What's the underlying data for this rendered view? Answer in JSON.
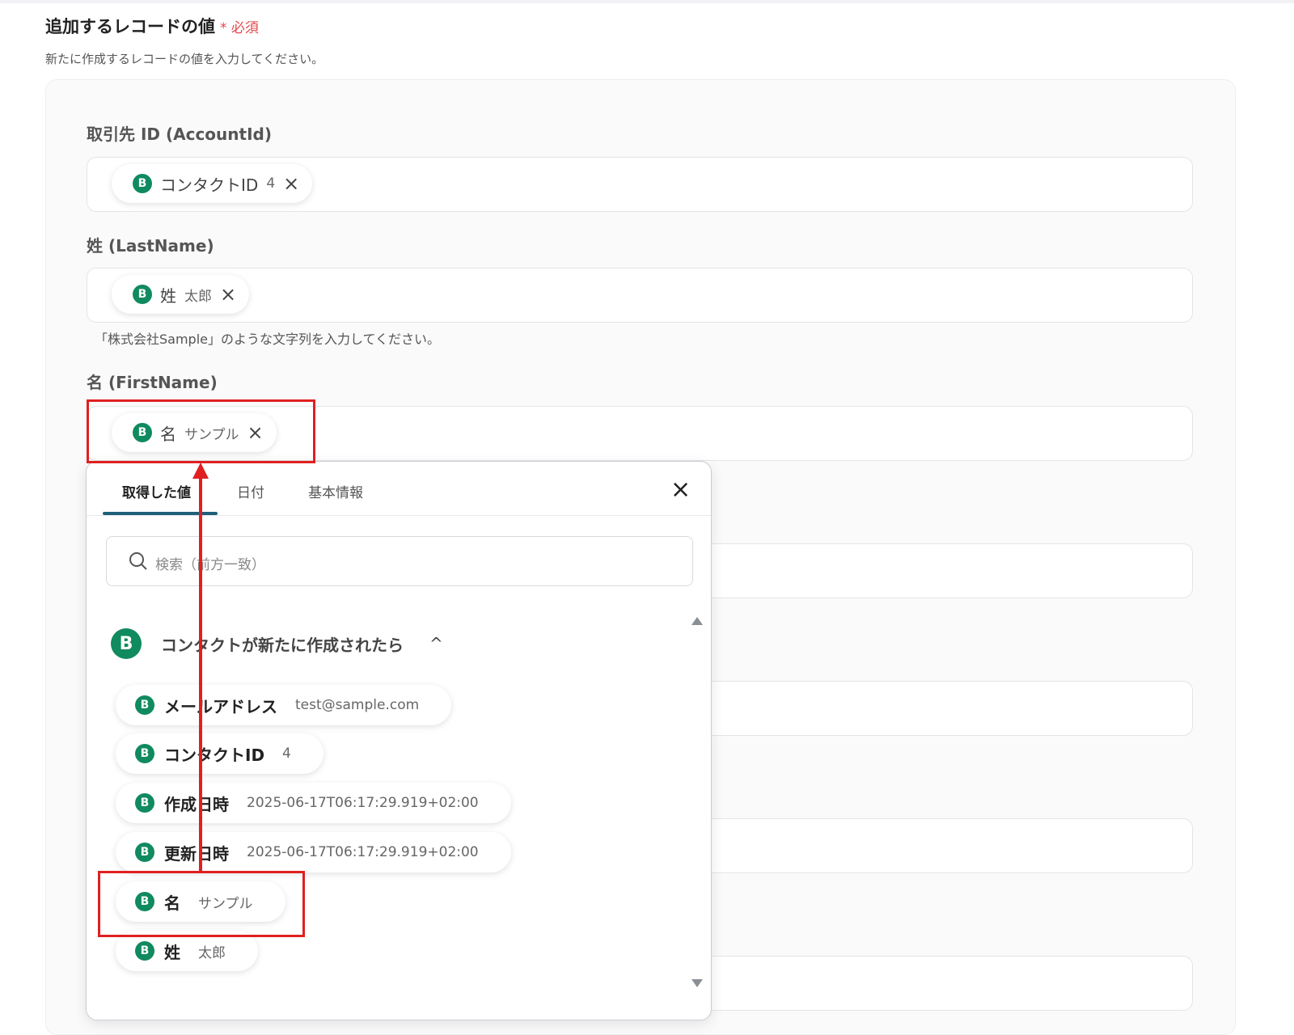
{
  "section": {
    "title": "追加するレコードの値",
    "required": "* 必須",
    "description": "新たに作成するレコードの値を入力してください。"
  },
  "fields": [
    {
      "label": "取引先 ID (AccountId)",
      "chip_name": "コンタクトID",
      "chip_value": "4"
    },
    {
      "label": "姓 (LastName)",
      "chip_name": "姓",
      "chip_value": "太郎",
      "help": "「株式会社Sample」のような文字列を入力してください。"
    },
    {
      "label": "名 (FirstName)",
      "chip_name": "名",
      "chip_value": "サンプル"
    }
  ],
  "popup": {
    "tabs": [
      "取得した値",
      "日付",
      "基本情報"
    ],
    "active_tab": "取得した値",
    "search_placeholder": "検索（前方一致）",
    "group_title": "コンタクトが新たに作成されたら",
    "items": [
      {
        "name": "メールアドレス",
        "value": "test@sample.com"
      },
      {
        "name": "コンタクトID",
        "value": "4"
      },
      {
        "name": "作成日時",
        "value": "2025-06-17T06:17:29.919+02:00"
      },
      {
        "name": "更新日時",
        "value": "2025-06-17T06:17:29.919+02:00"
      },
      {
        "name": "名",
        "value": "サンプル"
      },
      {
        "name": "姓",
        "value": "太郎"
      }
    ]
  },
  "icons": {
    "service": "B",
    "close": "×",
    "chevron": "^"
  },
  "colors": {
    "brand_green": "#108a5f",
    "annotation_red": "#e02020",
    "tab_underline": "#1f5f7a"
  }
}
